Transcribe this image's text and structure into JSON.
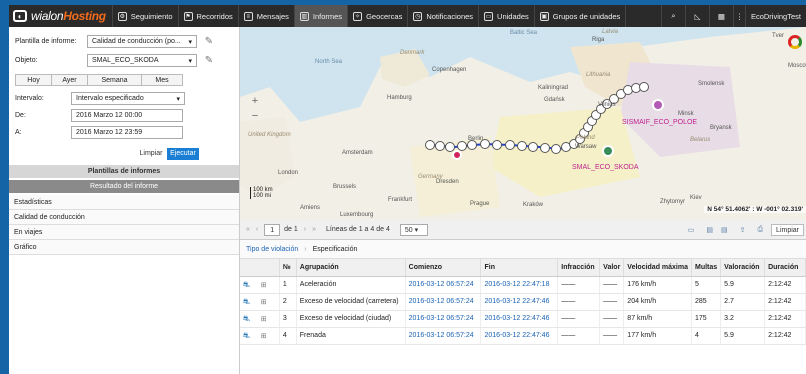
{
  "brand": {
    "name": "wialon",
    "name2": "Hosting"
  },
  "nav": [
    {
      "label": "Seguimiento",
      "icon": "gear-icon"
    },
    {
      "label": "Recorridos",
      "icon": "flag-icon"
    },
    {
      "label": "Mensajes",
      "icon": "list-icon"
    },
    {
      "label": "Informes",
      "icon": "chart-icon"
    },
    {
      "label": "Geocercas",
      "icon": "geofence-icon"
    },
    {
      "label": "Notificaciones",
      "icon": "clock-icon"
    },
    {
      "label": "Unidades",
      "icon": "car-icon"
    },
    {
      "label": "Grupos de unidades",
      "icon": "group-icon"
    }
  ],
  "user": "EcoDrivingTest",
  "panel": {
    "template_label": "Plantilla de informe:",
    "template_value": "Calidad de conducción (po...",
    "object_label": "Objeto:",
    "object_value": "SMAL_ECO_SKODA",
    "periods": [
      "Hoy",
      "Ayer",
      "Semana",
      "Mes"
    ],
    "interval_label": "Intervalo:",
    "interval_value": "Intervalo especificado",
    "from_label": "De:",
    "from_value": "2016 Marzo 12 00:00",
    "to_label": "A:",
    "to_value": "2016 Marzo 12 23:59",
    "clear": "Limpiar",
    "execute": "Ejecutar",
    "templates_band": "Plantillas de informes",
    "result_band": "Resultado del informe",
    "sections": [
      "Estadísticas",
      "Calidad de conducción",
      "En viajes",
      "Gráfico"
    ]
  },
  "map": {
    "labels": [
      "Baltic Sea",
      "North Sea",
      "Latvia",
      "Riga",
      "Denmark",
      "Copenhagen",
      "Lithuania",
      "Kaliningrad",
      "Smolensk",
      "Gdańsk",
      "Tver",
      "Vilnius",
      "Moscow",
      "Minsk",
      "Hamburg",
      "Belarus",
      "Bryansk",
      "United Kingdom",
      "Amsterdam",
      "London",
      "Berlin",
      "Warsaw",
      "Germany",
      "Poland",
      "Brussels",
      "Frankfurt",
      "Prague",
      "Dresden",
      "Kraków",
      "Zhytomyr",
      "Kiev",
      "Luxembourg",
      "Amiens"
    ],
    "unit1": "SISMAIF_ECO_POLOE",
    "unit2": "SMAL_ECO_SKODA",
    "coords": "N 54° 51.4062' : W -001° 02.319'",
    "scale_km": "100 km",
    "scale_mi": "100 mi"
  },
  "toolbar": {
    "page": "1",
    "of": "de 1",
    "lines": "Líneas de 1 a 4 de 4",
    "per_page": "50",
    "clear": "Limpiar"
  },
  "tabs": {
    "tab1": "Tipo de violación",
    "tab2": "Especificación"
  },
  "table": {
    "headers": [
      "№",
      "Agrupación",
      "Comienzo",
      "Fin",
      "Infracción",
      "Valor",
      "Velocidad máxima",
      "Multas",
      "Valoración",
      "Duración"
    ],
    "rows": [
      [
        "1",
        "Aceleración",
        "2016-03-12 06:57:24",
        "2016-03-12 22:47:18",
        "——",
        "——",
        "176 km/h",
        "5",
        "5.9",
        "2:12:42"
      ],
      [
        "2",
        "Exceso de velocidad (carretera)",
        "2016-03-12 06:57:24",
        "2016-03-12 22:47:46",
        "——",
        "——",
        "204 km/h",
        "285",
        "2.7",
        "2:12:42"
      ],
      [
        "3",
        "Exceso de velocidad (ciudad)",
        "2016-03-12 06:57:24",
        "2016-03-12 22:47:46",
        "——",
        "——",
        "87 km/h",
        "175",
        "3.2",
        "2:12:42"
      ],
      [
        "4",
        "Frenada",
        "2016-03-12 06:57:24",
        "2016-03-12 22:47:46",
        "——",
        "——",
        "177 km/h",
        "4",
        "5.9",
        "2:12:42"
      ]
    ]
  }
}
